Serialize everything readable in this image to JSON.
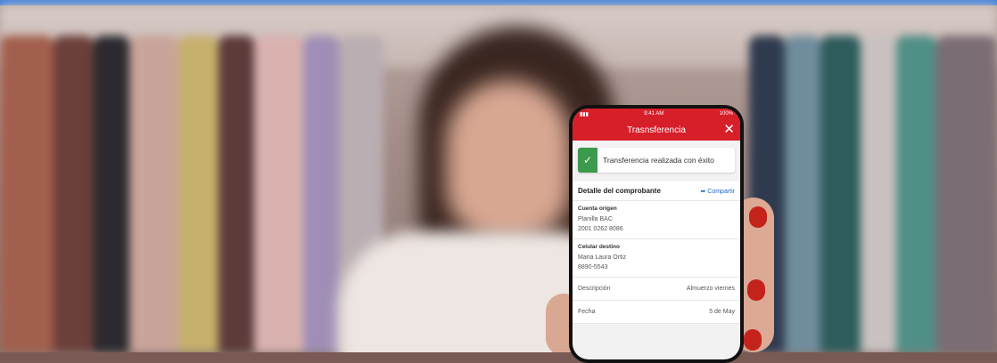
{
  "phone": {
    "status": {
      "time": "9:41 AM",
      "battery": "100%"
    },
    "header_title": "Trasnsferencia",
    "close_glyph": "✕",
    "success": {
      "icon": "check-icon",
      "message": "Transferencia realizada con éxito"
    },
    "detail": {
      "title": "Detalle del comprobante",
      "share_label": "Compartir"
    },
    "cuenta_origen": {
      "label": "Cuenta origen",
      "name": "Planilla BAC",
      "number": "2001 0262 8086"
    },
    "celular_destino": {
      "label": "Celular destino",
      "name": "Maria Laura Ortiz",
      "number": "8890-5543"
    },
    "rows": [
      {
        "label": "Descripción",
        "value": "Almuerzo viernes"
      },
      {
        "label": "Fecha",
        "value": "5 de May"
      }
    ]
  },
  "colors": {
    "brand_red": "#d71f2a",
    "success_green": "#3c9a4c",
    "link_blue": "#1f66c9"
  }
}
